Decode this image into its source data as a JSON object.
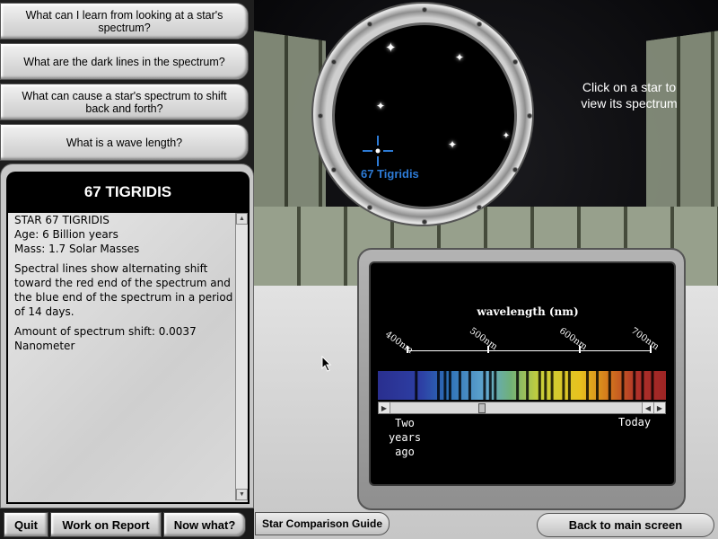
{
  "questions": [
    "What can I learn from looking at a star's spectrum?",
    "What are the dark lines in the spectrum?",
    "What can cause a star's spectrum to shift back and forth?",
    "What is a wave length?"
  ],
  "info": {
    "title": "67 TIGRIDIS",
    "line1": "STAR 67 TIGRIDIS",
    "line2": "Age: 6 Billion years",
    "line3": "Mass: 1.7 Solar Masses",
    "paragraph": "Spectral lines show alternating shift toward the red end of the spectrum and the blue end of the spectrum in a period of 14 days.",
    "shift": "Amount of spectrum shift: 0.0037 Nanometer"
  },
  "bottom_buttons": {
    "quit": "Quit",
    "report": "Work on Report",
    "now_what": "Now what?"
  },
  "scene": {
    "selected_star_label": "67 Tigridis",
    "instruction": "Click on a star to view its spectrum",
    "star_icon": "four-point-star-icon"
  },
  "spectrum": {
    "axis_label": "wavelength (nm)",
    "ticks": [
      "400nm",
      "500nm",
      "600nm",
      "700nm"
    ],
    "slider_left_label": "Two years ago",
    "slider_right_label": "Today",
    "slider_position": 0.36,
    "dark_lines_nm": [
      425,
      452,
      460,
      466,
      478,
      490,
      508,
      515,
      521,
      548,
      560,
      575,
      582,
      590,
      604,
      611,
      633,
      645,
      660,
      676,
      690,
      700,
      712
    ]
  },
  "guide_button": "Star Comparison Guide",
  "back_button": "Back to main screen",
  "colors": {
    "selected_star": "#2d7bd6",
    "panel_bg": "#c8c8c8",
    "screen_bg": "#000000"
  }
}
